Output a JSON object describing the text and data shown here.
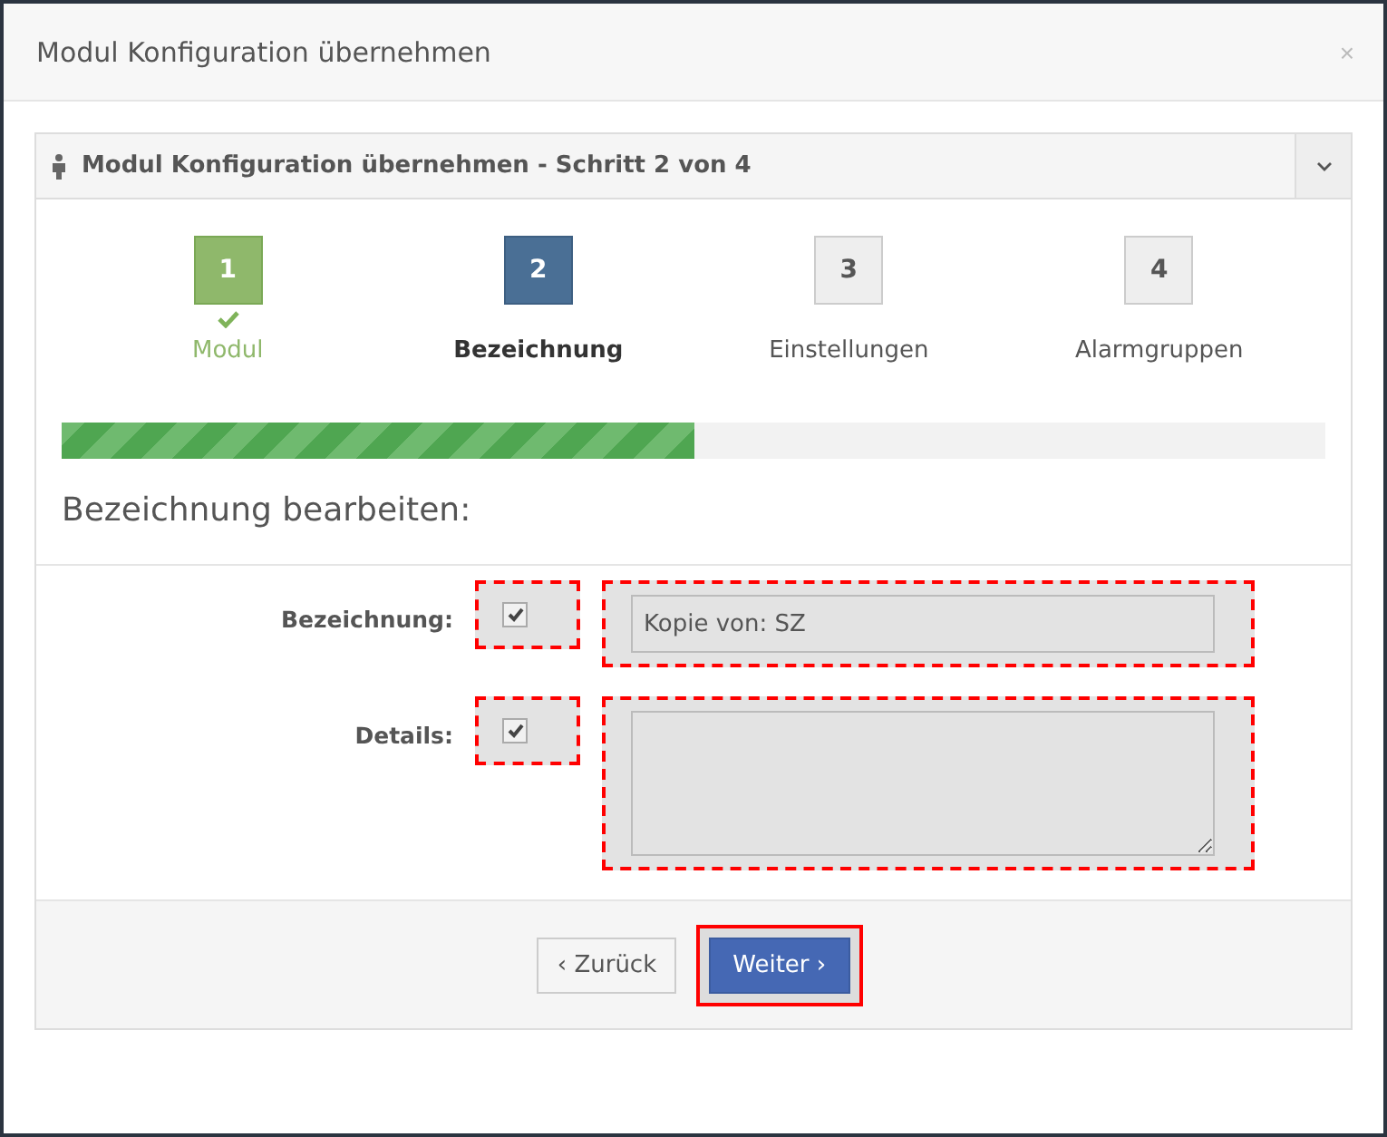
{
  "window": {
    "title": "Modul Konfiguration übernehmen",
    "close": "×"
  },
  "panel": {
    "title": "Modul Konfiguration übernehmen - Schritt 2 von 4",
    "expanded": true
  },
  "steps": [
    {
      "number": "1",
      "label": "Modul",
      "completed": true,
      "selected": false
    },
    {
      "number": "2",
      "label": "Bezeichnung",
      "completed": false,
      "selected": true
    },
    {
      "number": "3",
      "label": "Einstellungen",
      "completed": false,
      "selected": false
    },
    {
      "number": "4",
      "label": "Alarmgruppen",
      "completed": false,
      "selected": false
    }
  ],
  "progress": {
    "level": 0.5
  },
  "section_title": "Bezeichnung bearbeiten:",
  "fields": [
    {
      "kind": "text",
      "label": "Bezeichnung:",
      "checked": true,
      "value": "Kopie von: SZ",
      "highlighted": true
    },
    {
      "kind": "textarea",
      "label": "Details:",
      "checked": true,
      "highlighted": true
    }
  ],
  "buttons": [
    {
      "label": "‹ Zurück",
      "kind": "default",
      "highlighted": false
    },
    {
      "label": "Weiter ›",
      "kind": "primary",
      "highlighted": true
    }
  ]
}
